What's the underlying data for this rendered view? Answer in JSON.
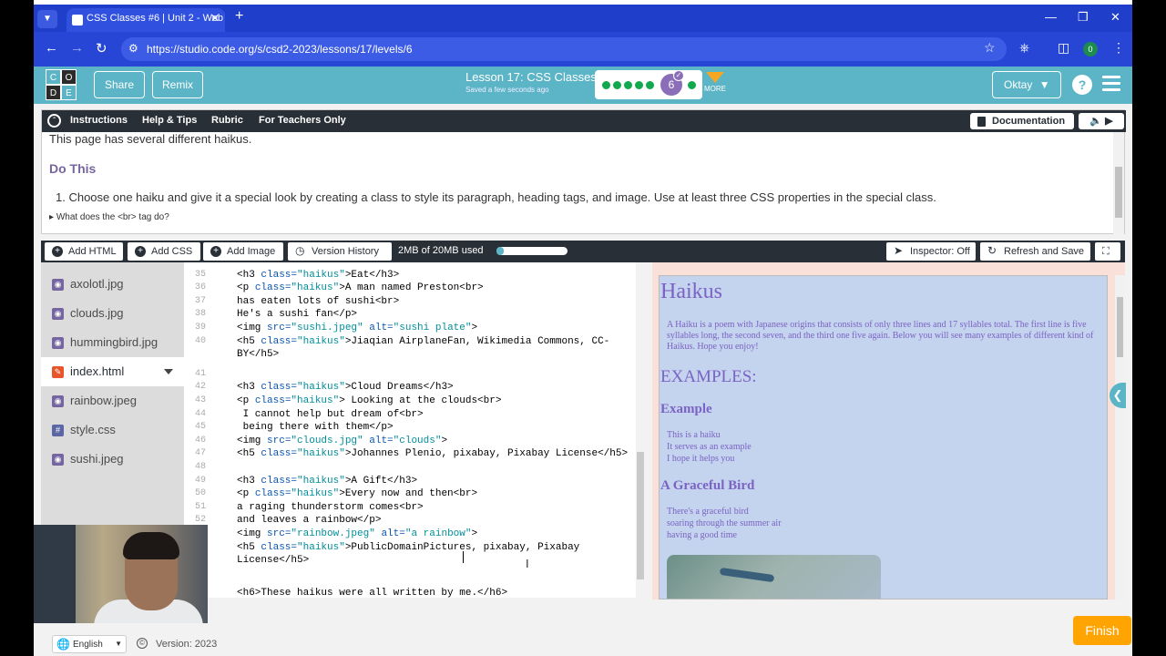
{
  "browser": {
    "tab_title": "CSS Classes #6 | Unit 2 - Web D",
    "url": "https://studio.code.org/s/csd2-2023/lessons/17/levels/6",
    "extension_badge": "0"
  },
  "header": {
    "logo_letters": [
      "C",
      "O",
      "D",
      "E"
    ],
    "share_label": "Share",
    "remix_label": "Remix",
    "lesson_title": "Lesson 17: CSS Classes",
    "saved_status": "Saved a few seconds ago",
    "current_level": "6",
    "more_label": "MORE",
    "user_name": "Oktay",
    "help_label": "?"
  },
  "instructions": {
    "tabs": [
      "Instructions",
      "Help & Tips",
      "Rubric",
      "For Teachers Only"
    ],
    "documentation_label": "Documentation",
    "intro_text": "This page has several different haikus.",
    "do_this_heading": "Do This",
    "step_1": "1. Choose one haiku and give it a special look by creating a class to style its paragraph, heading tags, and image. Use at least three CSS properties in the special class.",
    "br_question": "What does the <br> tag do?"
  },
  "toolbar": {
    "add_html": "Add HTML",
    "add_css": "Add CSS",
    "add_image": "Add Image",
    "version_history": "Version History",
    "usage": "2MB of 20MB used",
    "usage_fraction": 0.1,
    "inspector": "Inspector: Off",
    "refresh_save": "Refresh and Save"
  },
  "files": [
    {
      "name": "axolotl.jpg",
      "type": "image"
    },
    {
      "name": "clouds.jpg",
      "type": "image"
    },
    {
      "name": "hummingbird.jpg",
      "type": "image"
    },
    {
      "name": "index.html",
      "type": "html"
    },
    {
      "name": "rainbow.jpeg",
      "type": "image"
    },
    {
      "name": "style.css",
      "type": "css"
    },
    {
      "name": "sushi.jpeg",
      "type": "image"
    }
  ],
  "code_lines": [
    {
      "n": "34",
      "t": ""
    },
    {
      "n": "35",
      "t": "<h3 class=\"haikus\">Eat</h3>"
    },
    {
      "n": "36",
      "t": "<p class=\"haikus\">A man named Preston<br>"
    },
    {
      "n": "37",
      "t": "has eaten lots of sushi<br>"
    },
    {
      "n": "38",
      "t": "He's a sushi fan</p>"
    },
    {
      "n": "39",
      "t": "<img src=\"sushi.jpeg\" alt=\"sushi plate\">"
    },
    {
      "n": "40",
      "t": "<h5 class=\"haikus\">Jiaqian AirplaneFan, Wikimedia Commons, CC-"
    },
    {
      "n": "",
      "t": "BY</h5>"
    },
    {
      "n": "41",
      "t": ""
    },
    {
      "n": "42",
      "t": "<h3 class=\"haikus\">Cloud Dreams</h3>"
    },
    {
      "n": "43",
      "t": "<p class=\"haikus\"> Looking at the clouds<br>"
    },
    {
      "n": "44",
      "t": " I cannot help but dream of<br>"
    },
    {
      "n": "45",
      "t": " being there with them</p>"
    },
    {
      "n": "46",
      "t": "<img src=\"clouds.jpg\" alt=\"clouds\">"
    },
    {
      "n": "47",
      "t": "<h5 class=\"haikus\">Johannes Plenio, pixabay, Pixabay License</h5>"
    },
    {
      "n": "48",
      "t": ""
    },
    {
      "n": "49",
      "t": "<h3 class=\"haikus\">A Gift</h3>"
    },
    {
      "n": "50",
      "t": "<p class=\"haikus\">Every now and then<br>"
    },
    {
      "n": "51",
      "t": "a raging thunderstorm comes<br>"
    },
    {
      "n": "52",
      "t": "and leaves a rainbow</p>"
    },
    {
      "n": "53",
      "t": "<img src=\"rainbow.jpeg\" alt=\"a rainbow\">"
    },
    {
      "n": "54",
      "t": "<h5 class=\"haikus\">PublicDomainPictures, pixabay, Pixabay"
    },
    {
      "n": "",
      "t": "License</h5> "
    },
    {
      "n": "55",
      "t": ""
    },
    {
      "n": "56",
      "t": "<h6>These haikus were all written by me.</h6>"
    },
    {
      "n": "57",
      "t": "</body>"
    }
  ],
  "preview": {
    "title": "Haikus",
    "intro": "A Haiku is a poem with Japanese origins that consists of only three lines and 17 syllables total. The first line is five syllables long, the second seven, and the third one five again. Below you will see many examples of different kind of Haikus. Hope you enjoy!",
    "examples_heading": "EXAMPLES:",
    "h3_example": "Example",
    "example_lines": [
      "This is a haiku",
      "It serves as an example",
      "I hope it helps you"
    ],
    "h3_bird": "A Graceful Bird",
    "bird_lines": [
      "There's a graceful bird",
      "soaring through the summer air",
      "having a good time"
    ],
    "text_color": "#7b63c4",
    "bg_color": "#c4d3ee"
  },
  "footer": {
    "language": "English",
    "version": "Version: 2023",
    "finish_label": "Finish"
  }
}
